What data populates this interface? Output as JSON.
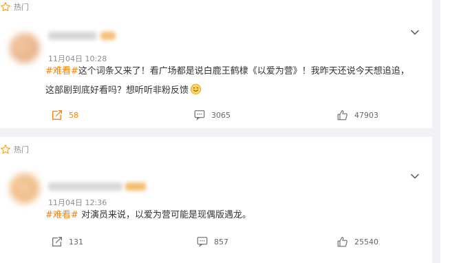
{
  "posts": [
    {
      "hot_label": "热门",
      "time": "11月04日 10:28",
      "tag": "#难看#",
      "text": "这个词条又来了！看广场都是说白鹿王鹤棣《以爱为营》！我昨天还说今天想追追，这部剧到底好看吗？想听听非粉反馈",
      "actions": {
        "repost": "58",
        "comment": "3065",
        "like": "47903"
      }
    },
    {
      "hot_label": "热门",
      "time": "11月04日 12:36",
      "tag": "#难看#",
      "text": "对演员来说，以爱为营可能是现偶版遇龙。",
      "actions": {
        "repost": "131",
        "comment": "857",
        "like": "25540"
      }
    }
  ],
  "colors": {
    "accent": "#ff8200",
    "hot_star": "#f5a623",
    "muted": "#8c8c8c"
  },
  "icons": [
    "star-icon",
    "chevron-down-icon",
    "repost-icon",
    "comment-icon",
    "like-icon",
    "smile-emoji-icon"
  ]
}
